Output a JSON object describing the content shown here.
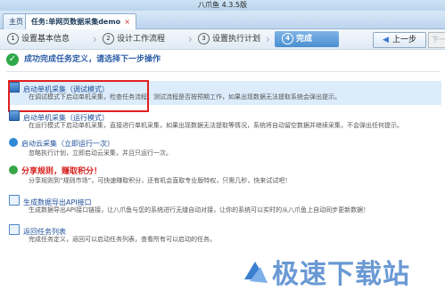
{
  "window": {
    "title": "八爪鱼 4.3.5版"
  },
  "tabs": [
    {
      "label": "主页"
    },
    {
      "label": "任务:单网页数据采集demo",
      "close": "×"
    }
  ],
  "steps": [
    {
      "num": "1",
      "label": "设置基本信息"
    },
    {
      "num": "2",
      "label": "设计工作流程"
    },
    {
      "num": "3",
      "label": "设置执行计划"
    },
    {
      "num": "4",
      "label": "完成"
    }
  ],
  "toolbar": {
    "prev_label": "上一步",
    "next_label": "下一"
  },
  "success_message": "成功完成任务定义，请选择下一步操作",
  "options": [
    {
      "title": "启动单机采集（调试模式）",
      "desc": "在调试模式下启动单机采集，检查任务流程，测试流程是否按预期工作，如果出现数据无法提取系统会弹出提示。",
      "icon": "monitor-icon"
    },
    {
      "title": "启动单机采集（运行模式）",
      "desc": "在运行模式下启动单机采集，直接进行单机采集，如果出现数据无法提取等情况，系统将自动留空数据并继续采集，不会弹出任何提示。",
      "icon": "monitor-icon"
    },
    {
      "title": "启动云采集（立即运行一次）",
      "desc": "忽略执行计划，立即启动云采集，并且只运行一次。",
      "icon": "cloud-icon"
    },
    {
      "title": "分享规则，赚取积分！",
      "desc": "分享规则到“规则市场”，可快速赚取积分，还有机会直取专业版特权，只需几秒，快来试试吧！",
      "icon": "share-icon"
    },
    {
      "title": "生成数据导出API接口",
      "desc": "生成数据导出API接口链接，让八爪鱼与您的系统进行无缝自动对接，让你的系统可以实时的从八爪鱼上自动同步更新数据！",
      "icon": "api-doc-icon"
    },
    {
      "title": "返回任务列表",
      "desc": "完成任务定义，返回可以启动任务列表，查看所有可以启动的任务。",
      "icon": "list-icon"
    }
  ],
  "watermark": "极速下载站",
  "colors": {
    "accent": "#4a8ed0",
    "link": "#1e4f9a",
    "highlight": "#e02020"
  }
}
